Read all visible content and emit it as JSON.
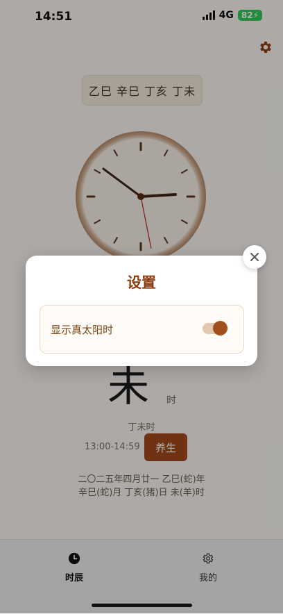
{
  "status_bar": {
    "time": "14:51",
    "network": "4G",
    "battery": "82"
  },
  "ganzhi": "乙巳 辛巳 丁亥 丁未",
  "hour_char": "未",
  "hour_suffix": "时",
  "hour_ganzhi": "丁未时",
  "time_range": "13:00-14:59",
  "yangsheng_label": "养生",
  "date_line_1": "二〇二五年四月廿一 乙巳(蛇)年",
  "date_line_2": "辛巳(蛇)月 丁亥(猪)日 未(羊)时",
  "tabs": [
    {
      "label": "时辰",
      "icon": "clock-icon",
      "active": true
    },
    {
      "label": "我的",
      "icon": "gear-icon",
      "active": false
    }
  ],
  "modal": {
    "title": "设置",
    "setting_label": "显示真太阳时",
    "toggle_on": true
  },
  "colors": {
    "accent": "#a0481c",
    "title": "#8a3f12",
    "battery": "#34c759"
  }
}
